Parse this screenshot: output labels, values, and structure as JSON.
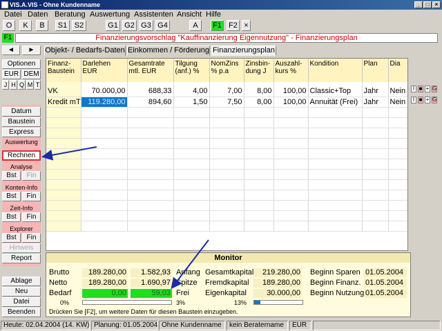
{
  "window": {
    "title": "VIS.A.VIS - Ohne Kundenname",
    "controls": [
      "_",
      "□",
      "×"
    ]
  },
  "menu": [
    "Datei",
    "Daten",
    "Beratung",
    "Auswertung",
    "Assistenten",
    "Ansicht",
    "Hilfe"
  ],
  "toolbar": [
    "O",
    "K",
    "B",
    "S1",
    "S2",
    "G1",
    "G2",
    "G3",
    "G4",
    "A",
    "F1",
    "F2",
    "×"
  ],
  "heading": {
    "f1": "F1",
    "text": "Finanzierungsvorschlag \"Kauffinanzierung Eigennutzung\" - Finanzierungsplan"
  },
  "left": {
    "nav_prev": "◄",
    "nav_next": "►",
    "optionen": "Optionen",
    "eur": "EUR",
    "dem": "DEM",
    "periods": [
      "J",
      "H",
      "Q",
      "M",
      "T"
    ],
    "datum": "Datum",
    "baustein": "Baustein",
    "express": "Express",
    "auswertung": "Auswertung",
    "rechnen": "Rechnen",
    "analyse": "Analyse",
    "bst": "Bst",
    "fin": "Fin",
    "konten_info": "Konten-Info",
    "zeit_info": "Zeit-Info",
    "explorer": "Explorer",
    "hinweis": "Hinweis",
    "report": "Report",
    "ablage": "Ablage",
    "neu": "Neu",
    "datei": "Datei",
    "beenden": "Beenden"
  },
  "tabs": [
    "Objekt- / Bedarfs-Daten",
    "Einkommen / Förderung",
    "Finanzierungsplan"
  ],
  "grid": {
    "headers": [
      [
        "Finanz-",
        "Baustein"
      ],
      [
        "Darlehen",
        "EUR"
      ],
      [
        "Gesamtrate",
        "mtl. EUR"
      ],
      [
        "Tilgung",
        "(anf.) %"
      ],
      [
        "NomZins",
        "% p.a"
      ],
      [
        "Zinsbin-",
        "dung J"
      ],
      [
        "Auszahl-",
        "kurs %"
      ],
      [
        "Kondition",
        ""
      ],
      [
        "Plan",
        ""
      ],
      [
        "Dia",
        ""
      ]
    ],
    "rows": [
      [
        "VK",
        "70.000,00",
        "688,33",
        "4,00",
        "7,00",
        "8,00",
        "100,00",
        "Classic+Top",
        "Jahr",
        "Nein"
      ],
      [
        "Kredit mT",
        "119.280,00",
        "894,60",
        "1,50",
        "7,50",
        "8,00",
        "100,00",
        "Annuität  (Frei)",
        "Jahr",
        "Nein"
      ]
    ],
    "row_actions": [
      "I",
      "■",
      "+",
      "G"
    ]
  },
  "monitor": {
    "title": "Monitor",
    "brutto_label": "Brutto",
    "brutto_val": "189.280,00",
    "brutto_rate": "1.582,93",
    "netto_label": "Netto",
    "netto_val": "189.280,00",
    "netto_rate": "1.690,97",
    "bedarf_label": "Bedarf",
    "bedarf_val": "0,00",
    "bedarf_rate": "59,03",
    "pct_left": "0%",
    "anfang": "Anfang",
    "spitze": "Spitze",
    "frei": "Frei",
    "pct_mid": "3%",
    "gesamtkapital_label": "Gesamtkapital",
    "gesamtkapital_val": "219.280,00",
    "fremdkapital_label": "Fremdkapital",
    "fremdkapital_val": "189.280,00",
    "eigenkapital_label": "Eigenkapital",
    "eigenkapital_val": "30.000,00",
    "pct_right": "13%",
    "beginn_sparen_label": "Beginn Sparen",
    "beginn_sparen_val": "01.05.2004",
    "beginn_finanz_label": "Beginn Finanz.",
    "beginn_finanz_val": "01.05.2004",
    "beginn_nutzung_label": "Beginn Nutzung",
    "beginn_nutzung_val": "01.05.2004",
    "bar_left_fill": 0.0,
    "bar_mid_fill": 0.03,
    "bar_right_fill": 0.13,
    "note": "Drücken Sie [F2], um weitere Daten für diesen Baustein einzugeben."
  },
  "status": {
    "heute": "Heute: 02.04.2004 (14. KW)",
    "planung": "Planung: 01.05.2004",
    "kunde": "Ohne Kundenname",
    "berater": "kein Beratername",
    "waehrung": "EUR"
  },
  "colors": {
    "accent_green": "#22dd22",
    "heading_red": "#cc0000",
    "pink_panel": "#f6b6b6",
    "selected_blue": "#1177cc",
    "annotation_arrow": "#1a2aa8"
  }
}
